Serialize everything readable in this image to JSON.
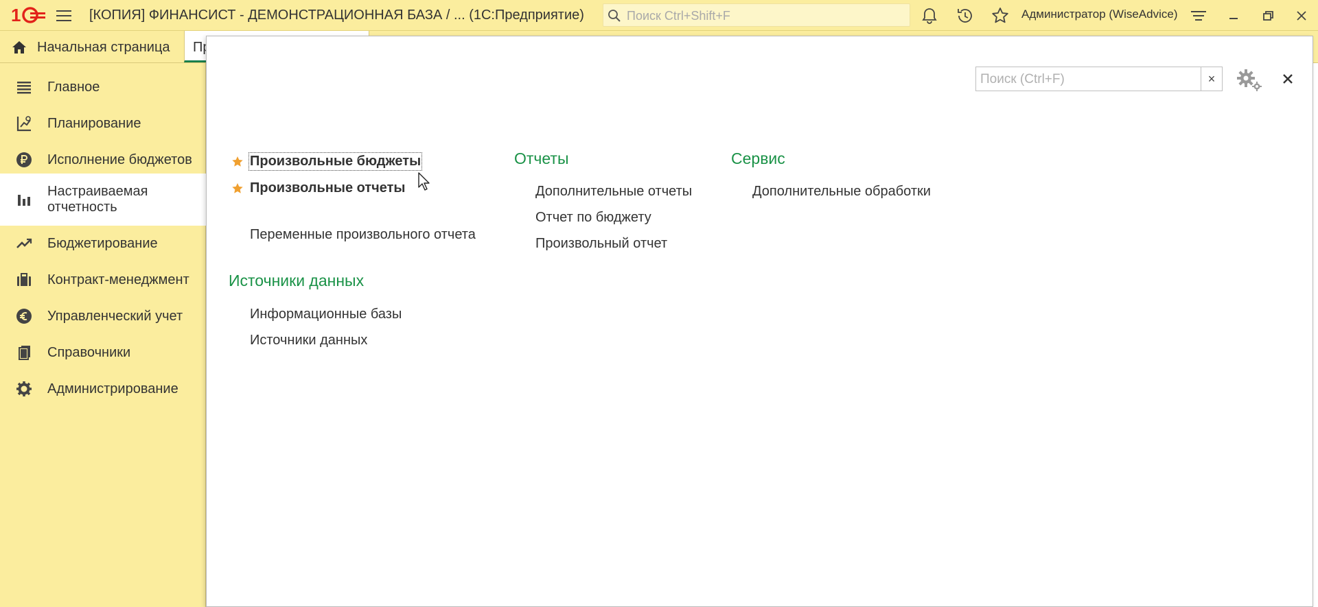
{
  "window": {
    "title": "[КОПИЯ] ФИНАНСИСТ - ДЕМОНСТРАЦИОННАЯ БАЗА / ...  (1С:Предприятие)",
    "search_placeholder": "Поиск Ctrl+Shift+F",
    "user": "Администратор (WiseAdvice)",
    "icons": [
      "logo-1c",
      "menu-icon",
      "bell-icon",
      "history-icon",
      "star-icon",
      "settings-menu-icon",
      "minimize-icon",
      "restore-icon",
      "close-icon"
    ]
  },
  "tabs": {
    "home_label": "Начальная страница",
    "second_label": "Пр"
  },
  "sidebar": {
    "items": [
      {
        "label": "Главное",
        "icon": "hamburger-icon"
      },
      {
        "label": "Планирование",
        "icon": "planning-icon"
      },
      {
        "label": "Исполнение бюджетов",
        "icon": "ruble-icon"
      },
      {
        "label": "Настраиваемая отчетность",
        "icon": "bar-chart-icon",
        "active": true
      },
      {
        "label": "Бюджетирование",
        "icon": "trend-icon"
      },
      {
        "label": "Контракт-менеджмент",
        "icon": "briefcase-icon"
      },
      {
        "label": "Управленческий учет",
        "icon": "euro-icon"
      },
      {
        "label": "Справочники",
        "icon": "books-icon"
      },
      {
        "label": "Администрирование",
        "icon": "gear-icon"
      }
    ]
  },
  "panel": {
    "search_placeholder": "Поиск (Ctrl+F)",
    "clear_label": "×",
    "close_label": "×",
    "col1": {
      "items": [
        {
          "label": "Произвольные бюджеты",
          "bold": true,
          "starred": true,
          "focused": true
        },
        {
          "label": "Произвольные отчеты",
          "bold": true,
          "starred": true
        },
        {
          "label": "Переменные произвольного отчета"
        }
      ],
      "group2_title": "Источники данных",
      "group2_items": [
        "Информационные базы",
        "Источники данных"
      ]
    },
    "col2": {
      "title": "Отчеты",
      "items": [
        "Дополнительные отчеты",
        "Отчет по бюджету",
        "Произвольный отчет"
      ]
    },
    "col3": {
      "title": "Сервис",
      "items": [
        "Дополнительные обработки"
      ]
    }
  },
  "colors": {
    "chrome_yellow": "#fbed9e",
    "group_green": "#1a9247",
    "star_orange": "#f0a030",
    "logo_red": "#e2231a"
  }
}
